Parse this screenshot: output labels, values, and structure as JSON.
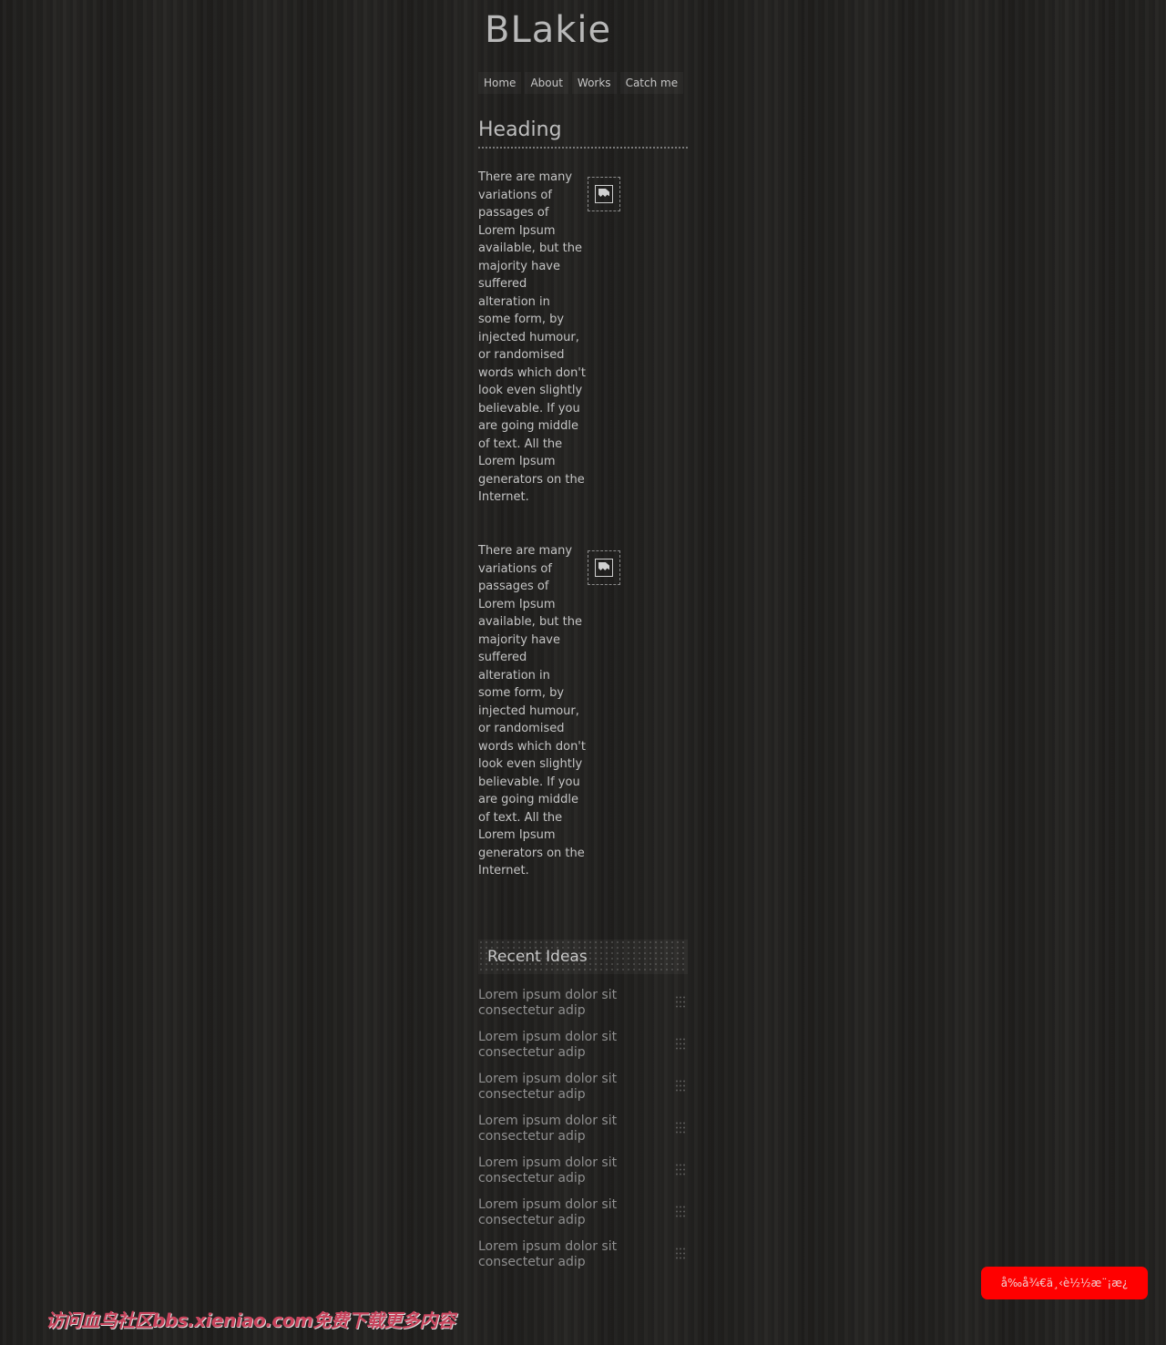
{
  "site": {
    "logo": "BLakie"
  },
  "nav": {
    "items": [
      {
        "label": "Home"
      },
      {
        "label": "About"
      },
      {
        "label": "Works"
      },
      {
        "label": "Catch me"
      }
    ]
  },
  "main": {
    "heading": "Heading",
    "articles": [
      {
        "text": "There are many variations of passages of Lorem Ipsum available, but the majority have suffered alteration in some form, by injected humour, or randomised words which don't look even slightly believable. If you are going middle of text. All the Lorem Ipsum generators on the Internet.",
        "thumb_icon": "broken-image-icon"
      },
      {
        "text": "There are many variations of passages of Lorem Ipsum available, but the majority have suffered alteration in some form, by injected humour, or randomised words which don't look even slightly believable. If you are going middle of text. All the Lorem Ipsum generators on the Internet.",
        "thumb_icon": "broken-image-icon"
      }
    ]
  },
  "recent": {
    "title": "Recent Ideas",
    "items": [
      {
        "label": "Lorem ipsum dolor sit consectetur adip"
      },
      {
        "label": "Lorem ipsum dolor sit consectetur adip"
      },
      {
        "label": "Lorem ipsum dolor sit consectetur adip"
      },
      {
        "label": "Lorem ipsum dolor sit consectetur adip"
      },
      {
        "label": "Lorem ipsum dolor sit consectetur adip"
      },
      {
        "label": "Lorem ipsum dolor sit consectetur adip"
      },
      {
        "label": "Lorem ipsum dolor sit consectetur adip"
      }
    ]
  },
  "cta": {
    "label": "å‰å¾€ä¸‹è½½æ¨¡æ¿",
    "color": "#ff0000"
  },
  "watermark": {
    "text": "访问血鸟社区bbs.xieniao.com免费下载更多内容"
  },
  "colors": {
    "background": "#232220",
    "text": "#c4c4c4",
    "muted_link": "#8f8f8f"
  }
}
